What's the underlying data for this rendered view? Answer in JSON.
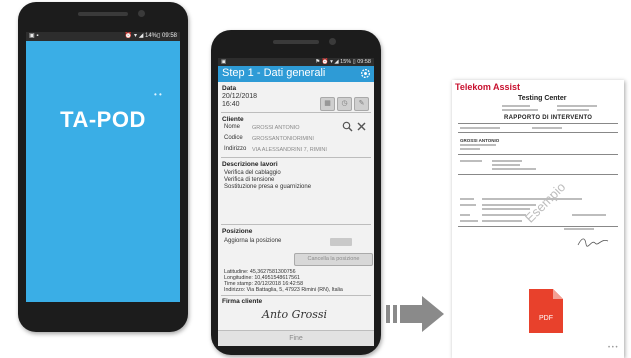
{
  "phone1": {
    "status_left": "▣ ▪",
    "status_right": "⏰ ▾ ◢ 14%▯ 09:58",
    "dots": "• •",
    "logo_text": "TA-POD",
    "screen_color": "#3aaee6"
  },
  "phone2": {
    "status_left": "▣",
    "status_right": "⚑ ⏰ ▾ ◢ 15% ▯ 09:58",
    "appbar_title": "Step 1 - Dati generali",
    "accent_color": "#2e9bd6",
    "data": {
      "label": "Data",
      "date": "20/12/2018",
      "time": "16:40"
    },
    "cliente": {
      "label": "Cliente",
      "nome_label": "Nome",
      "nome_value": "GROSSI ANTONIO",
      "codice_label": "Codice",
      "codice_value": "GROSSANTONIORIMINI",
      "indirizzo_label": "Indirizzo",
      "indirizzo_value": "VIA ALESSANDRINI 7, RIMINI"
    },
    "descrizione": {
      "label": "Descrizione lavori",
      "lines": [
        "Verifica del cablaggio",
        "Verifica di tensione",
        "Sostituzione presa e guarnizione"
      ]
    },
    "posizione": {
      "label": "Posizione",
      "aggiorna": "Aggiorna la posizione",
      "cancella": "Cancella la posizione",
      "info": [
        "Latitudine: 45,3627581300756",
        "Longitudine: 10,4951548617561",
        "Time stamp: 20/12/2018 16:42:58",
        "Indirizzo: Via Battaglia, 5, 47923 Rimini (RN), Italia"
      ]
    },
    "firma_label": "Firma cliente",
    "signature": "Anto Grossi",
    "fine_label": "Fine"
  },
  "document": {
    "brand": "Telekom Assist",
    "title": "Testing Center",
    "report_title": "RAPPORTO DI INTERVENTO",
    "cliente_name": "GROSSI ANTONIO",
    "watermark": "Esempio",
    "pdf_label": "PDF",
    "ellipsis": "• • •",
    "pdf_color": "#e8412c",
    "brand_color": "#c8102e"
  }
}
